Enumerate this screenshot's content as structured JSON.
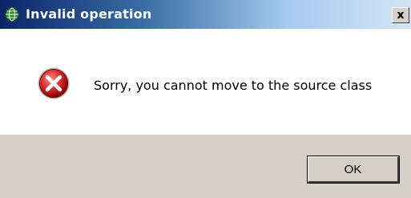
{
  "window": {
    "title": "Invalid operation",
    "app_icon": "eclipse-globe-icon",
    "close_label": "x"
  },
  "message": {
    "icon": "error-icon",
    "text": "Sorry, you cannot move to the source class"
  },
  "buttons": {
    "ok_label": "OK"
  },
  "colors": {
    "titlebar_start": "#0a246a",
    "titlebar_end": "#d4e4f6",
    "footer_bg": "#d4d0c8",
    "error_red": "#cc1f1f"
  }
}
